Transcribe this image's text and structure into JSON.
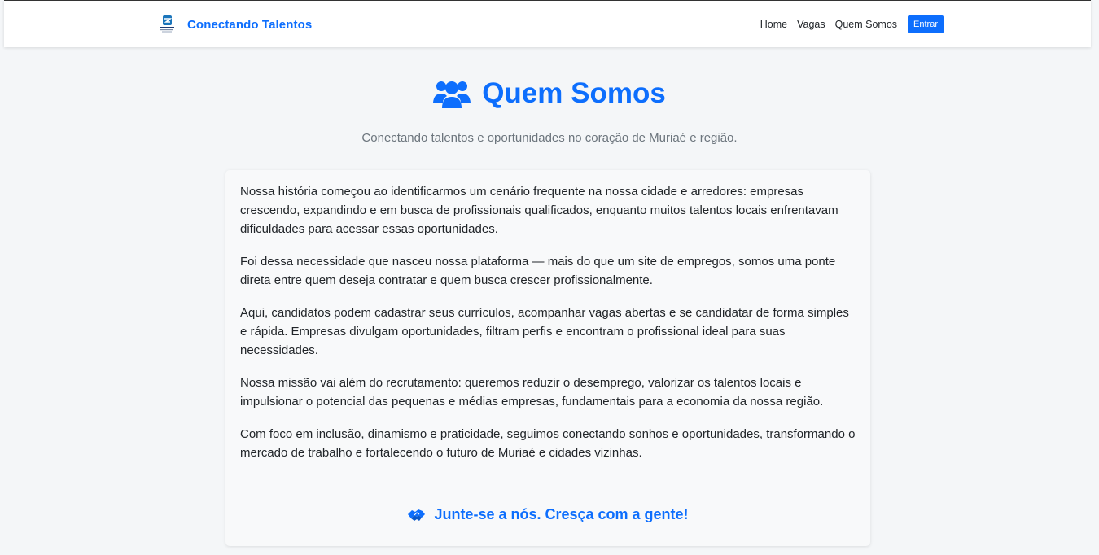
{
  "header": {
    "brand_name": "Conectando Talentos",
    "nav": {
      "home": "Home",
      "vagas": "Vagas",
      "quem_somos": "Quem Somos",
      "entrar": "Entrar"
    }
  },
  "hero": {
    "icon": "users-icon",
    "title": "Quem Somos",
    "subtitle": "Conectando talentos e oportunidades no coração de Muriaé e região."
  },
  "content": {
    "paragraphs": [
      "Nossa história começou ao identificarmos um cenário frequente na nossa cidade e arredores: empresas crescendo, expandindo e em busca de profissionais qualificados, enquanto muitos talentos locais enfrentavam dificuldades para acessar essas oportunidades.",
      "Foi dessa necessidade que nasceu nossa plataforma — mais do que um site de empregos, somos uma ponte direta entre quem deseja contratar e quem busca crescer profissionalmente.",
      "Aqui, candidatos podem cadastrar seus currículos, acompanhar vagas abertas e se candidatar de forma simples e rápida. Empresas divulgam oportunidades, filtram perfis e encontram o profissional ideal para suas necessidades.",
      "Nossa missão vai além do recrutamento: queremos reduzir o desemprego, valorizar os talentos locais e impulsionar o potencial das pequenas e médias empresas, fundamentais para a economia da nossa região.",
      "Com foco em inclusão, dinamismo e praticidade, seguimos conectando sonhos e oportunidades, transformando o mercado de trabalho e fortalecendo o futuro de Muriaé e cidades vizinhas."
    ],
    "cta": "Junte-se a nós. Cresça com a gente!",
    "cta_icon": "handshake-icon"
  },
  "colors": {
    "accent": "#0d6efd",
    "background": "#f4f6f8",
    "muted_text": "#6c757d"
  }
}
